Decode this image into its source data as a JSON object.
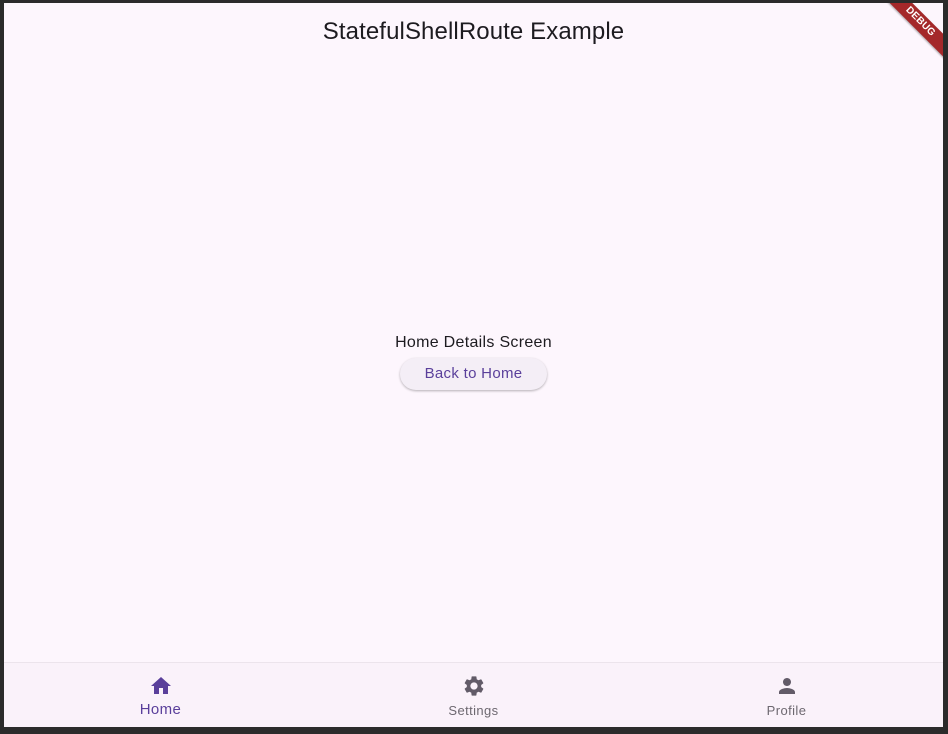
{
  "app_bar": {
    "title": "StatefulShellRoute Example"
  },
  "body": {
    "screen_label": "Home Details Screen",
    "back_button_label": "Back to Home"
  },
  "bottom_nav": {
    "items": [
      {
        "label": "Home",
        "icon": "home-icon",
        "active": true
      },
      {
        "label": "Settings",
        "icon": "gear-icon",
        "active": false
      },
      {
        "label": "Profile",
        "icon": "person-icon",
        "active": false
      }
    ]
  },
  "debug_banner": {
    "label": "DEBUG"
  },
  "colors": {
    "background": "#fdf6fd",
    "accent": "#5a3f9b",
    "inactive": "#6d6870",
    "debug_banner": "#a4282a"
  }
}
